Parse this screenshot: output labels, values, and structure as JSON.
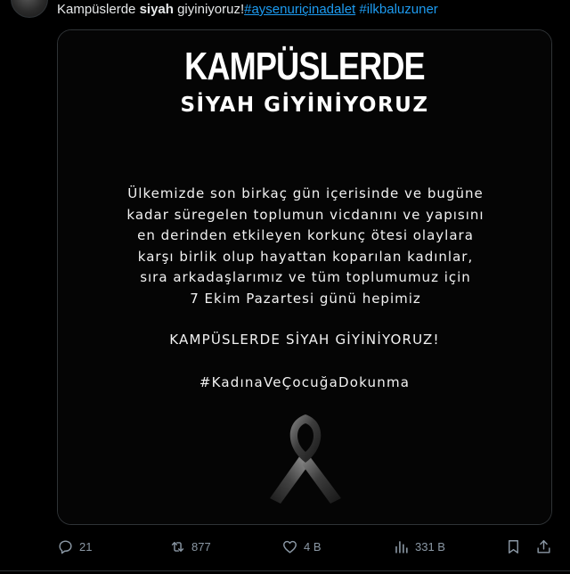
{
  "tweet": {
    "text_prefix": "Kampüslerde ",
    "text_bold": "siyah",
    "text_suffix": " giyiniyoruz!",
    "hashtags": [
      "#aysenuriçinadalet",
      "#ilkbaluzuner"
    ]
  },
  "poster": {
    "title_line1": "KAMPÜSLERDE",
    "title_line2": "SİYAH GİYİNİYORUZ",
    "body_lines": [
      "Ülkemizde son birkaç gün içerisinde ve bugüne",
      "kadar süregelen toplumun vicdanını ve yapısını",
      "en derinden etkileyen korkunç ötesi olaylara",
      "karşı birlik olup hayattan koparılan kadınlar,",
      "sıra arkadaşlarımız ve tüm toplumumuz için",
      "7 Ekim Pazartesi günü hepimiz"
    ],
    "slogan": "KAMPÜSLERDE SİYAH GİYİNİYORUZ!",
    "hashtag": "#KadınaVeÇocuğaDokunma",
    "ribbon_icon": "black-ribbon-icon"
  },
  "actions": {
    "replies": "21",
    "reposts": "877",
    "likes": "4 B",
    "views": "331 B"
  },
  "icons": {
    "reply": "reply-icon",
    "repost": "repost-icon",
    "like": "heart-icon",
    "views": "views-icon",
    "bookmark": "bookmark-icon",
    "share": "share-icon"
  },
  "colors": {
    "background": "#000000",
    "text": "#e7e9ea",
    "hashtag": "#1d9bf0",
    "muted": "#8b98a5",
    "border": "#2f3336"
  }
}
